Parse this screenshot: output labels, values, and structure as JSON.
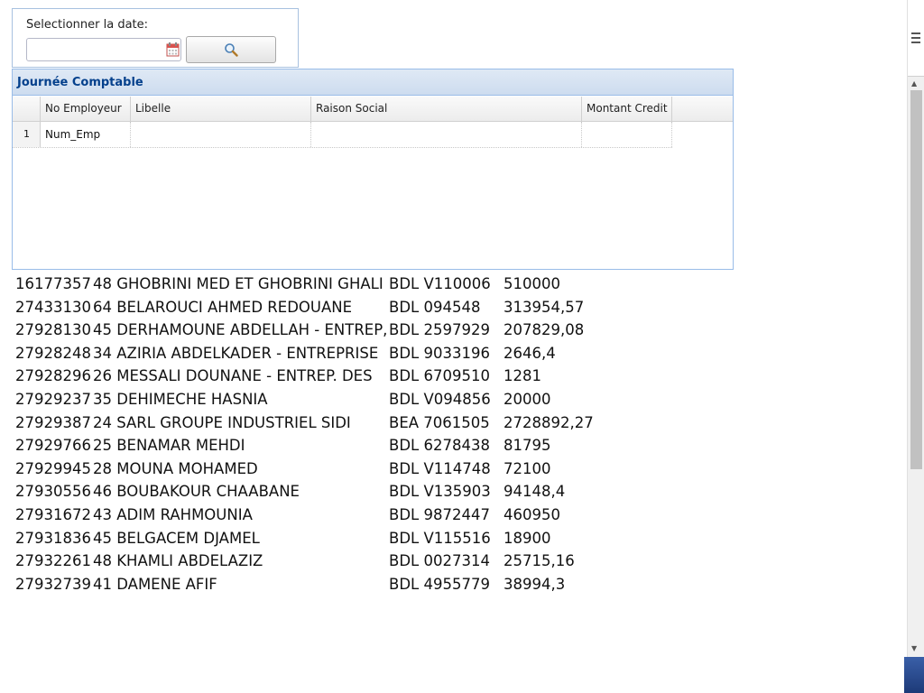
{
  "date_panel": {
    "label": "Selectionner la date:",
    "date_value": "",
    "calendar_icon": "calendar-icon",
    "search_icon": "magnifier-icon"
  },
  "grid": {
    "title": "Journée Comptable",
    "columns": [
      "No Employeur",
      "Libelle",
      "Raison Social",
      "Montant Credit"
    ],
    "rows": [
      {
        "num": "1",
        "no_employeur": "Num_Emp",
        "libelle": "",
        "raison_social": "",
        "montant_credit": ""
      }
    ]
  },
  "records": [
    {
      "code": "16177357",
      "name": "48 GHOBRINI MED ET GHOBRINI GHALI",
      "ref": "BDL V110006",
      "amount": "510000"
    },
    {
      "code": "27433130",
      "name": "64 BELAROUCI AHMED REDOUANE",
      "ref": "BDL 094548",
      "amount": "313954,57"
    },
    {
      "code": "27928130",
      "name": "45 DERHAMOUNE ABDELLAH - ENTREP,",
      "ref": "BDL 2597929",
      "amount": "207829,08"
    },
    {
      "code": "27928248",
      "name": "34 AZIRIA ABDELKADER - ENTREPRISE",
      "ref": "BDL 9033196",
      "amount": "2646,4"
    },
    {
      "code": "27928296",
      "name": "26 MESSALI DOUNANE - ENTREP. DES",
      "ref": "BDL 6709510",
      "amount": "1281"
    },
    {
      "code": "27929237",
      "name": "35 DEHIMECHE HASNIA",
      "ref": "BDL V094856",
      "amount": "20000"
    },
    {
      "code": "27929387",
      "name": "24 SARL GROUPE INDUSTRIEL SIDI",
      "ref": "BEA 7061505",
      "amount": "2728892,27"
    },
    {
      "code": "27929766",
      "name": "25 BENAMAR MEHDI",
      "ref": "BDL 6278438",
      "amount": "81795"
    },
    {
      "code": "27929945",
      "name": "28 MOUNA MOHAMED",
      "ref": "BDL V114748",
      "amount": "72100"
    },
    {
      "code": "27930556",
      "name": "46 BOUBAKOUR CHAABANE",
      "ref": "BDL V135903",
      "amount": "94148,4"
    },
    {
      "code": "27931672",
      "name": "43 ADIM RAHMOUNIA",
      "ref": "BDL 9872447",
      "amount": "460950"
    },
    {
      "code": "27931836",
      "name": "45 BELGACEM DJAMEL",
      "ref": "BDL V115516",
      "amount": "18900"
    },
    {
      "code": "27932261",
      "name": "48 KHAMLI ABDELAZIZ",
      "ref": "BDL 0027314",
      "amount": "25715,16"
    },
    {
      "code": "27932739",
      "name": "41 DAMENE AFIF",
      "ref": "BDL 4955779",
      "amount": "38994,3"
    }
  ],
  "colors": {
    "panel_border": "#99bce8",
    "title_text": "#04408c",
    "title_bg": "#dfe9f5"
  }
}
